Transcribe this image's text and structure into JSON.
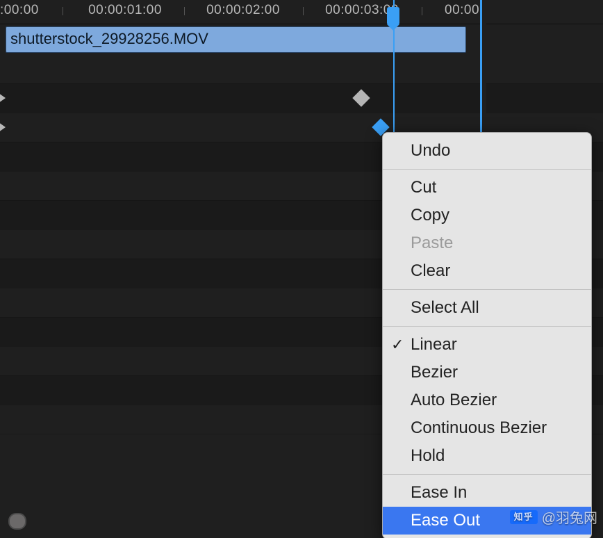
{
  "ruler": {
    "labels": [
      ":00:00",
      "00:00:01:00",
      "00:00:02:00",
      "00:00:03:00",
      "00:00"
    ]
  },
  "clip": {
    "name": "shutterstock_29928256.MOV"
  },
  "menu": {
    "undo": "Undo",
    "cut": "Cut",
    "copy": "Copy",
    "paste": "Paste",
    "clear": "Clear",
    "select_all": "Select All",
    "linear": "Linear",
    "bezier": "Bezier",
    "auto_bezier": "Auto Bezier",
    "cont_bezier": "Continuous Bezier",
    "hold": "Hold",
    "ease_in": "Ease In",
    "ease_out": "Ease Out"
  },
  "watermark": {
    "logo_text": "知乎",
    "text": "@羽兔网"
  }
}
